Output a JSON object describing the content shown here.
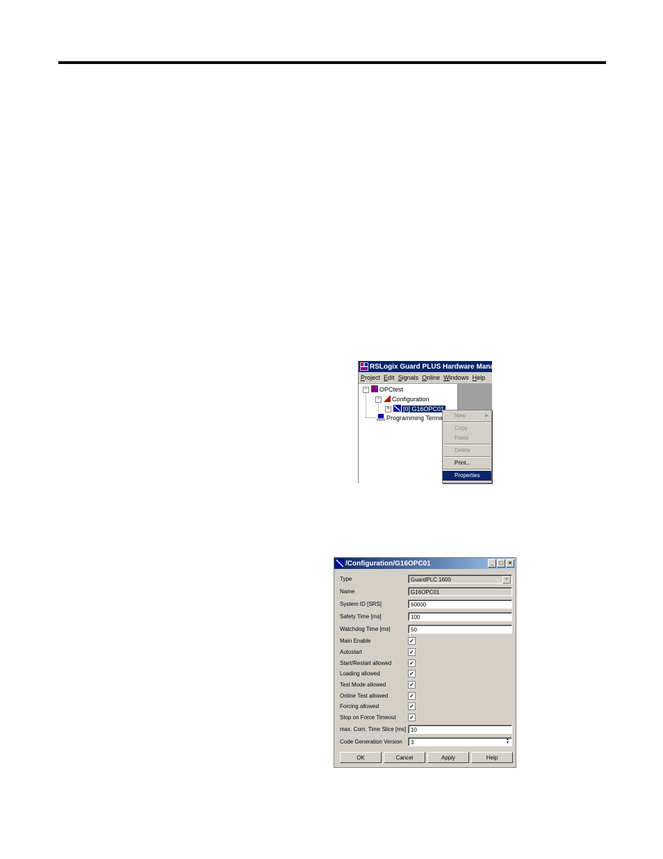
{
  "main_window": {
    "title": "RSLogix Guard PLUS Hardware Management",
    "menu": [
      "Project",
      "Edit",
      "Signals",
      "Online",
      "Windows",
      "Help"
    ],
    "tree": {
      "root": "OPCtest",
      "configuration": "Configuration",
      "device_prefix": "[0]",
      "device": "G16OPC01",
      "terminal": "Programming Terminal"
    },
    "context_menu": {
      "new": "New",
      "copy": "Copy",
      "paste": "Paste",
      "delete": "Delete",
      "print": "Print...",
      "properties": "Properties"
    }
  },
  "dialog": {
    "title": "/Configuration/G16OPC01",
    "type_label": "Type",
    "type_value": "GuardPLC 1600",
    "name_label": "Name",
    "name_value": "G16OPC01",
    "system_id_label": "System ID [SRS]",
    "system_id_value": "60000",
    "safety_time_label": "Safety Time [ms]",
    "safety_time_value": "100",
    "watchdog_label": "Watchdog Time [ms]",
    "watchdog_value": "50",
    "checkboxes": [
      {
        "label": "Main Enable",
        "checked": true
      },
      {
        "label": "Autostart",
        "checked": true
      },
      {
        "label": "Start/Restart allowed",
        "checked": true
      },
      {
        "label": "Loading allowed",
        "checked": true
      },
      {
        "label": "Test Mode allowed",
        "checked": true
      },
      {
        "label": "Online Test allowed",
        "checked": true
      },
      {
        "label": "Forcing allowed",
        "checked": true
      },
      {
        "label": "Stop on Force Timeout",
        "checked": true
      }
    ],
    "check_mark": "✓",
    "time_slice_label": "max. Com. Time Slice [ms]",
    "time_slice_value": "10",
    "codegen_label": "Code Generation Version",
    "codegen_value": "3",
    "buttons": {
      "ok": "OK",
      "cancel": "Cancel",
      "apply": "Apply",
      "help": "Help"
    }
  },
  "colors": {
    "titlebar": "#0a246a",
    "face": "#d4d0c8",
    "selection": "#0a246a"
  }
}
